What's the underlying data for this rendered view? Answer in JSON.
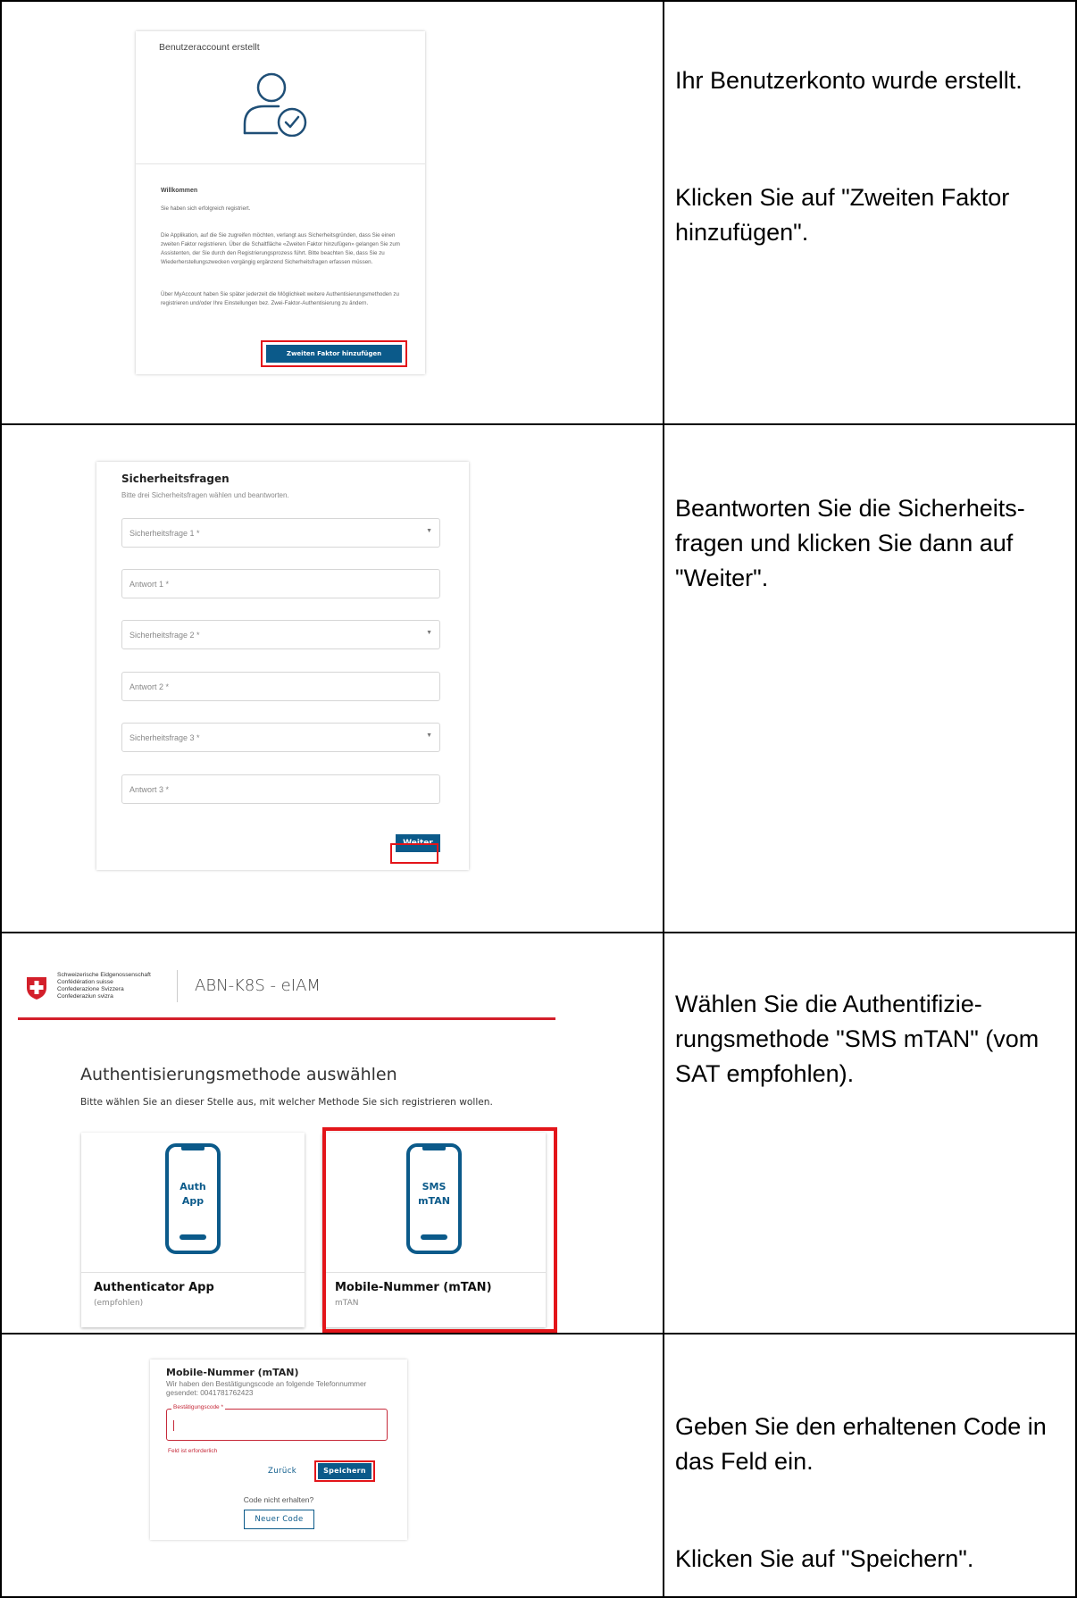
{
  "sections": [
    {
      "screenshot": {
        "title": "Benutzeraccount erstellt",
        "welcome": "Willkommen",
        "p1": "Sie haben sich erfolgreich registriert.",
        "p2": "Die Applikation, auf die Sie zugreifen möchten, verlangt aus Sicherheitsgründen, dass Sie einen zweiten Faktor registrieren. Über die Schaltfläche «Zweiten Faktor hinzufügen» gelangen Sie zum Assistenten, der Sie durch den Registrierungsprozess führt. Bitte beachten Sie, dass Sie zu Wiederherstellungszwecken vorgängig ergänzend Sicherheitsfragen erfassen müssen.",
        "p3": "Über MyAccount haben Sie später jederzeit die Möglichkeit weitere Authentisierungsmethoden zu registrieren und/oder Ihre Einstellungen bez. Zwei-Faktor-Authentisierung zu ändern.",
        "button": "Zweiten Faktor hinzufügen",
        "icon": "user-check-icon"
      },
      "instructions": [
        "Ihr Benutzerkonto wurde erstellt.",
        "Klicken Sie auf \"Zweiten Faktor hinzufügen\"."
      ]
    },
    {
      "screenshot": {
        "title": "Sicherheitsfragen",
        "subtitle": "Bitte drei Sicherheitsfragen wählen und beantworten.",
        "fields": [
          "Sicherheitsfrage 1 *",
          "Antwort 1 *",
          "Sicherheitsfrage 2 *",
          "Antwort 2 *",
          "Sicherheitsfrage 3 *",
          "Antwort 3 *"
        ],
        "button": "Weiter"
      },
      "instructions": [
        "Beantworten Sie die Sicherheits-fragen und klicken Sie dann auf \"Weiter\"."
      ]
    },
    {
      "screenshot": {
        "confederation": [
          "Schweizerische Eidgenossenschaft",
          "Confédération suisse",
          "Confederazione Svizzera",
          "Confederaziun svizra"
        ],
        "app_title": "ABN-K8S - eIAM",
        "heading": "Authentisierungsmethode auswählen",
        "subheading": "Bitte wählen Sie an dieser Stelle aus, mit welcher Methode Sie sich registrieren wollen.",
        "methods": [
          {
            "phone_label": [
              "Auth",
              "App"
            ],
            "name": "Authenticator App",
            "note": "(empfohlen)"
          },
          {
            "phone_label": [
              "SMS",
              "mTAN"
            ],
            "name": "Mobile-Nummer (mTAN)",
            "note": "mTAN"
          }
        ],
        "brand_red": "#d31f2a",
        "phone_blue": "#0b5a8a"
      },
      "instructions": [
        "Wählen Sie die Authentifizie-rungsmethode \"SMS mTAN\" (vom SAT empfohlen)."
      ]
    },
    {
      "screenshot": {
        "title": "Mobile-Nummer (mTAN)",
        "subtitle": "Wir haben den Bestätigungscode an folgende Telefonnummer gesendet: 0041781762423",
        "field_label": "Bestätigungscode *",
        "error": "Feld ist erforderlich",
        "back": "Zurück",
        "save": "Speichern",
        "no_code": "Code nicht erhalten?",
        "new_code": "Neuer Code"
      },
      "instructions": [
        "Geben Sie den erhaltenen Code in das Feld ein.",
        "Klicken Sie auf \"Speichern\"."
      ]
    }
  ]
}
